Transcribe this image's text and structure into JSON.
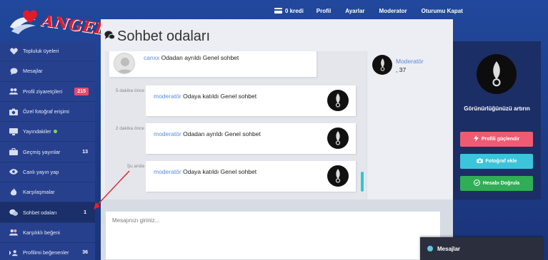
{
  "brand": {
    "logo_text": "ANGELS."
  },
  "topnav": {
    "credit": "0 kredi",
    "profile": "Profil",
    "settings": "Ayarlar",
    "moderator": "Moderator",
    "logout": "Oturumu Kapat"
  },
  "sidebar": {
    "items": [
      {
        "label": "Topluluk üyeleri",
        "icon": "heart-icon",
        "badge": ""
      },
      {
        "label": "Mesajlar",
        "icon": "chat-bubble-icon",
        "badge": ""
      },
      {
        "label": "Profil ziyaretçileri",
        "icon": "users-icon",
        "badge": "215"
      },
      {
        "label": "Özel fotoğraf erişimi",
        "icon": "camera-icon",
        "badge": ""
      },
      {
        "label": "Yayındakiler",
        "icon": "monitor-icon",
        "badge": ""
      },
      {
        "label": "Geçmiş yayınlar",
        "icon": "briefcase-icon",
        "badge": "13"
      },
      {
        "label": "Canlı yayın yap",
        "icon": "eye-icon",
        "badge": ""
      },
      {
        "label": "Karşılaşmalar",
        "icon": "fire-icon",
        "badge": ""
      },
      {
        "label": "Sohbet odaları",
        "icon": "chat-bubbles-icon",
        "badge": "1"
      },
      {
        "label": "Karşılıklı beğeni",
        "icon": "couple-icon",
        "badge": ""
      },
      {
        "label": "Profilimi beğenenler",
        "icon": "user-like-icon",
        "badge": "36"
      }
    ]
  },
  "main": {
    "title": "Sohbet odaları",
    "messages": [
      {
        "time": "",
        "user": "canxx",
        "text": " Odadan ayrıldı Genel sohbet"
      },
      {
        "time": "5 dakika önce",
        "user": "moderatör",
        "text": " Odaya katıldı Genel sohbet"
      },
      {
        "time": "2 dakika önce",
        "user": "moderatör",
        "text": " Odadan ayrıldı Genel sohbet"
      },
      {
        "time": "Şu anda",
        "user": "moderatör",
        "text": " Odaya katıldı Genel sohbet"
      }
    ],
    "members": [
      {
        "name": "Moderatör",
        "age": ", 37"
      }
    ],
    "input_placeholder": "Mesajınızı giriniz..."
  },
  "right_panel": {
    "heading": "Görünürlüğünüzü artırın",
    "boost_label": "Profili güçlendir",
    "photo_label": "Fotoğraf ekle",
    "verify_label": "Hesabı Doğrula"
  },
  "chat_widget": {
    "label": "Mesajlar"
  },
  "colors": {
    "accent_red": "#ef5b72",
    "accent_cyan": "#3cc4da",
    "accent_green": "#2fae55",
    "sidebar_bg": "#27408e"
  }
}
